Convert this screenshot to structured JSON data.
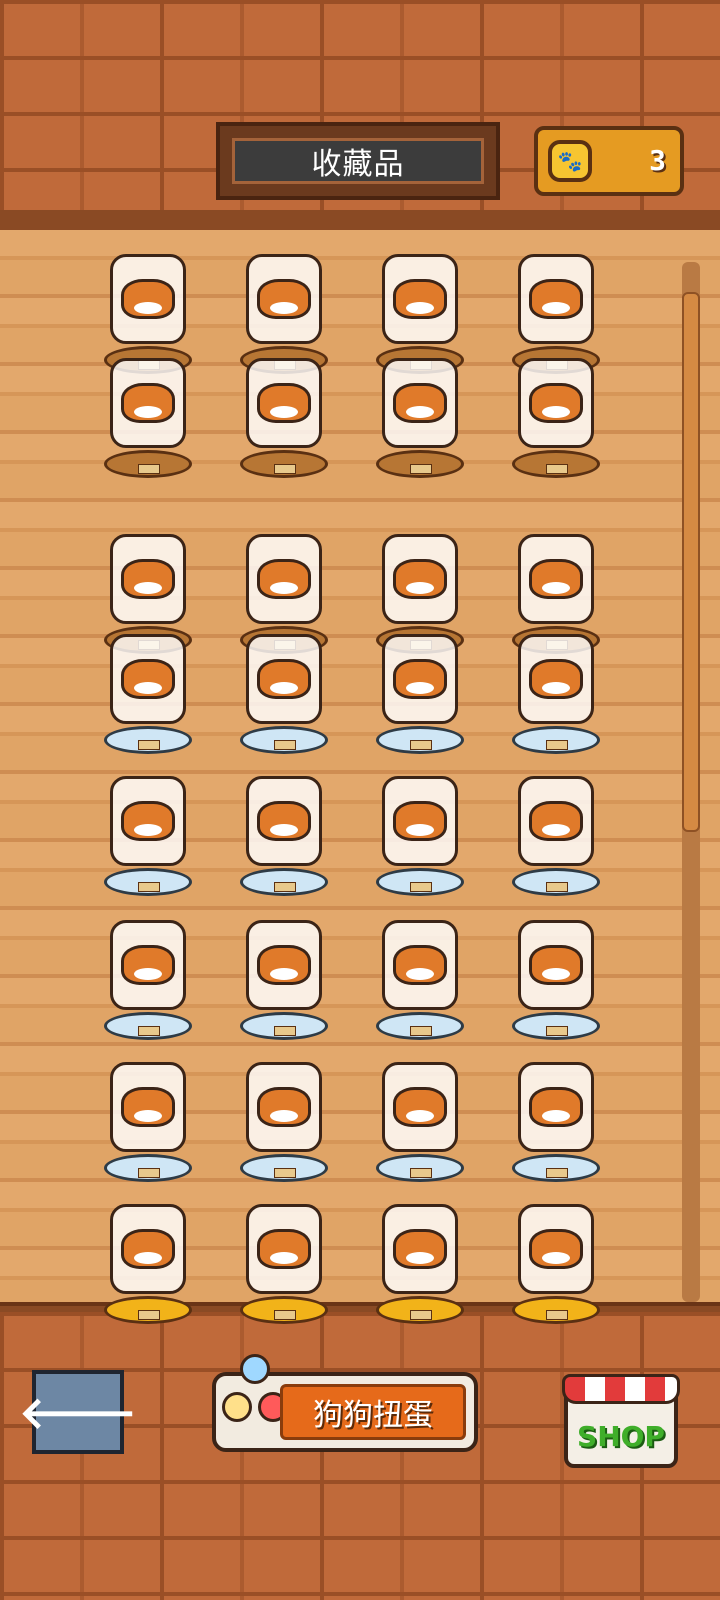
{
  "header": {
    "title": "收藏品",
    "coin_icon": "paw-coin-icon",
    "coin_count": "3"
  },
  "collection": {
    "items": [
      {
        "name": "dog-lying",
        "base": "wood"
      },
      {
        "name": "dog-framed-picture",
        "base": "wood"
      },
      {
        "name": "dog-sitting",
        "base": "wood"
      },
      {
        "name": "dog-with-bowl",
        "base": "wood"
      },
      {
        "name": "dog-with-plant",
        "base": "wood"
      },
      {
        "name": "dog-floor-lamp",
        "base": "wood"
      },
      {
        "name": "dog-wardrobe",
        "base": "wood"
      },
      {
        "name": "dog-table-plant",
        "base": "wood"
      },
      {
        "name": "dog-sleeping",
        "base": "wood"
      },
      {
        "name": "dog-red-hat",
        "base": "wood"
      },
      {
        "name": "dog-with-bone",
        "base": "wood"
      },
      {
        "name": "dog-with-laptop",
        "base": "wood"
      },
      {
        "name": "dog-armchair",
        "base": "glass"
      },
      {
        "name": "dog-red-cabinet",
        "base": "glass"
      },
      {
        "name": "dog-round-window",
        "base": "glass"
      },
      {
        "name": "dog-sofa",
        "base": "glass"
      },
      {
        "name": "dog-dresser-bone",
        "base": "glass"
      },
      {
        "name": "green-dog",
        "base": "glass"
      },
      {
        "name": "dog-computer",
        "base": "glass"
      },
      {
        "name": "dog-mirror",
        "base": "glass"
      },
      {
        "name": "dog-speaker",
        "base": "glass"
      },
      {
        "name": "dog-tv-stand",
        "base": "glass"
      },
      {
        "name": "dog-planter",
        "base": "glass"
      },
      {
        "name": "dog-red-bed",
        "base": "glass"
      },
      {
        "name": "dog-with-owner",
        "base": "glass"
      },
      {
        "name": "dog-dining-table",
        "base": "glass"
      },
      {
        "name": "dog-scratching-post",
        "base": "glass"
      },
      {
        "name": "dog-with-bowls",
        "base": "glass"
      },
      {
        "name": "dog-bathtub",
        "base": "gold"
      },
      {
        "name": "dog-mirror-egg",
        "base": "gold"
      },
      {
        "name": "dog-sink-table",
        "base": "gold"
      },
      {
        "name": "dog-door",
        "base": "gold"
      }
    ]
  },
  "footer": {
    "back_icon": "arrow-left-icon",
    "back_glyph": "🡐",
    "gacha_label": "狗狗扭蛋",
    "shop_label": "SHOP"
  }
}
